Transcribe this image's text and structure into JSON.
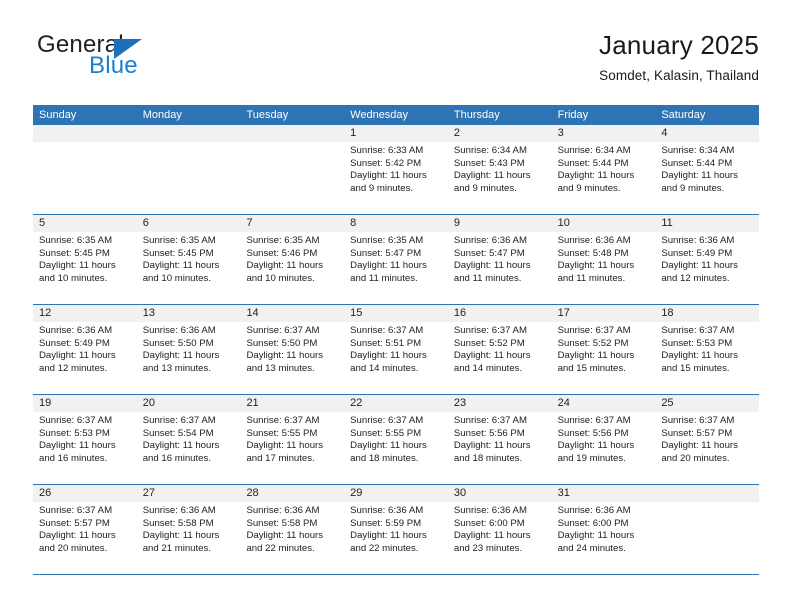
{
  "logo": {
    "word_one": "General",
    "word_two": "Blue",
    "triangle_color": "#1c6fb8"
  },
  "header": {
    "title": "January 2025",
    "subtitle": "Somdet, Kalasin, Thailand",
    "accent_color": "#2e74b5",
    "day_band_color": "#f1f1f1"
  },
  "weekdays": [
    "Sunday",
    "Monday",
    "Tuesday",
    "Wednesday",
    "Thursday",
    "Friday",
    "Saturday"
  ],
  "weeks": [
    [
      {
        "day": "",
        "lines": []
      },
      {
        "day": "",
        "lines": []
      },
      {
        "day": "",
        "lines": []
      },
      {
        "day": "1",
        "lines": [
          "Sunrise: 6:33 AM",
          "Sunset: 5:42 PM",
          "Daylight: 11 hours",
          "and 9 minutes."
        ]
      },
      {
        "day": "2",
        "lines": [
          "Sunrise: 6:34 AM",
          "Sunset: 5:43 PM",
          "Daylight: 11 hours",
          "and 9 minutes."
        ]
      },
      {
        "day": "3",
        "lines": [
          "Sunrise: 6:34 AM",
          "Sunset: 5:44 PM",
          "Daylight: 11 hours",
          "and 9 minutes."
        ]
      },
      {
        "day": "4",
        "lines": [
          "Sunrise: 6:34 AM",
          "Sunset: 5:44 PM",
          "Daylight: 11 hours",
          "and 9 minutes."
        ]
      }
    ],
    [
      {
        "day": "5",
        "lines": [
          "Sunrise: 6:35 AM",
          "Sunset: 5:45 PM",
          "Daylight: 11 hours",
          "and 10 minutes."
        ]
      },
      {
        "day": "6",
        "lines": [
          "Sunrise: 6:35 AM",
          "Sunset: 5:45 PM",
          "Daylight: 11 hours",
          "and 10 minutes."
        ]
      },
      {
        "day": "7",
        "lines": [
          "Sunrise: 6:35 AM",
          "Sunset: 5:46 PM",
          "Daylight: 11 hours",
          "and 10 minutes."
        ]
      },
      {
        "day": "8",
        "lines": [
          "Sunrise: 6:35 AM",
          "Sunset: 5:47 PM",
          "Daylight: 11 hours",
          "and 11 minutes."
        ]
      },
      {
        "day": "9",
        "lines": [
          "Sunrise: 6:36 AM",
          "Sunset: 5:47 PM",
          "Daylight: 11 hours",
          "and 11 minutes."
        ]
      },
      {
        "day": "10",
        "lines": [
          "Sunrise: 6:36 AM",
          "Sunset: 5:48 PM",
          "Daylight: 11 hours",
          "and 11 minutes."
        ]
      },
      {
        "day": "11",
        "lines": [
          "Sunrise: 6:36 AM",
          "Sunset: 5:49 PM",
          "Daylight: 11 hours",
          "and 12 minutes."
        ]
      }
    ],
    [
      {
        "day": "12",
        "lines": [
          "Sunrise: 6:36 AM",
          "Sunset: 5:49 PM",
          "Daylight: 11 hours",
          "and 12 minutes."
        ]
      },
      {
        "day": "13",
        "lines": [
          "Sunrise: 6:36 AM",
          "Sunset: 5:50 PM",
          "Daylight: 11 hours",
          "and 13 minutes."
        ]
      },
      {
        "day": "14",
        "lines": [
          "Sunrise: 6:37 AM",
          "Sunset: 5:50 PM",
          "Daylight: 11 hours",
          "and 13 minutes."
        ]
      },
      {
        "day": "15",
        "lines": [
          "Sunrise: 6:37 AM",
          "Sunset: 5:51 PM",
          "Daylight: 11 hours",
          "and 14 minutes."
        ]
      },
      {
        "day": "16",
        "lines": [
          "Sunrise: 6:37 AM",
          "Sunset: 5:52 PM",
          "Daylight: 11 hours",
          "and 14 minutes."
        ]
      },
      {
        "day": "17",
        "lines": [
          "Sunrise: 6:37 AM",
          "Sunset: 5:52 PM",
          "Daylight: 11 hours",
          "and 15 minutes."
        ]
      },
      {
        "day": "18",
        "lines": [
          "Sunrise: 6:37 AM",
          "Sunset: 5:53 PM",
          "Daylight: 11 hours",
          "and 15 minutes."
        ]
      }
    ],
    [
      {
        "day": "19",
        "lines": [
          "Sunrise: 6:37 AM",
          "Sunset: 5:53 PM",
          "Daylight: 11 hours",
          "and 16 minutes."
        ]
      },
      {
        "day": "20",
        "lines": [
          "Sunrise: 6:37 AM",
          "Sunset: 5:54 PM",
          "Daylight: 11 hours",
          "and 16 minutes."
        ]
      },
      {
        "day": "21",
        "lines": [
          "Sunrise: 6:37 AM",
          "Sunset: 5:55 PM",
          "Daylight: 11 hours",
          "and 17 minutes."
        ]
      },
      {
        "day": "22",
        "lines": [
          "Sunrise: 6:37 AM",
          "Sunset: 5:55 PM",
          "Daylight: 11 hours",
          "and 18 minutes."
        ]
      },
      {
        "day": "23",
        "lines": [
          "Sunrise: 6:37 AM",
          "Sunset: 5:56 PM",
          "Daylight: 11 hours",
          "and 18 minutes."
        ]
      },
      {
        "day": "24",
        "lines": [
          "Sunrise: 6:37 AM",
          "Sunset: 5:56 PM",
          "Daylight: 11 hours",
          "and 19 minutes."
        ]
      },
      {
        "day": "25",
        "lines": [
          "Sunrise: 6:37 AM",
          "Sunset: 5:57 PM",
          "Daylight: 11 hours",
          "and 20 minutes."
        ]
      }
    ],
    [
      {
        "day": "26",
        "lines": [
          "Sunrise: 6:37 AM",
          "Sunset: 5:57 PM",
          "Daylight: 11 hours",
          "and 20 minutes."
        ]
      },
      {
        "day": "27",
        "lines": [
          "Sunrise: 6:36 AM",
          "Sunset: 5:58 PM",
          "Daylight: 11 hours",
          "and 21 minutes."
        ]
      },
      {
        "day": "28",
        "lines": [
          "Sunrise: 6:36 AM",
          "Sunset: 5:58 PM",
          "Daylight: 11 hours",
          "and 22 minutes."
        ]
      },
      {
        "day": "29",
        "lines": [
          "Sunrise: 6:36 AM",
          "Sunset: 5:59 PM",
          "Daylight: 11 hours",
          "and 22 minutes."
        ]
      },
      {
        "day": "30",
        "lines": [
          "Sunrise: 6:36 AM",
          "Sunset: 6:00 PM",
          "Daylight: 11 hours",
          "and 23 minutes."
        ]
      },
      {
        "day": "31",
        "lines": [
          "Sunrise: 6:36 AM",
          "Sunset: 6:00 PM",
          "Daylight: 11 hours",
          "and 24 minutes."
        ]
      },
      {
        "day": "",
        "lines": []
      }
    ]
  ]
}
